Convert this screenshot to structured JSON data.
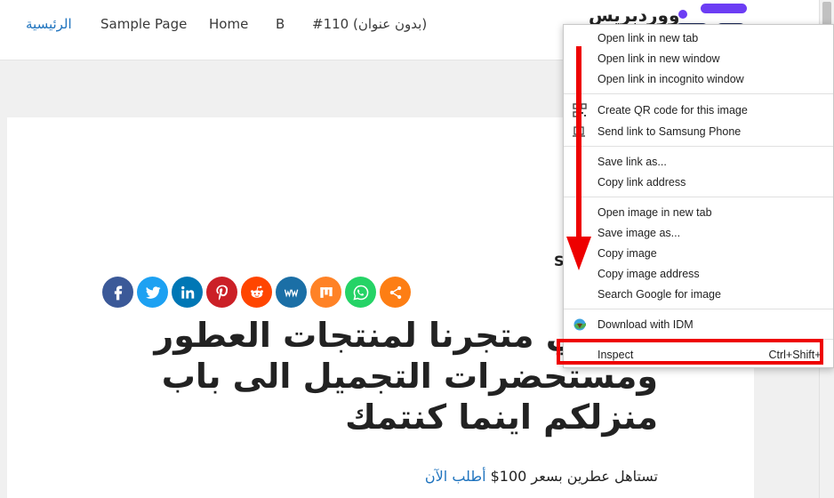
{
  "nav": {
    "home_ar": "الرئيسية",
    "sample_page": "Sample Page",
    "home": "Home",
    "b": "B",
    "untitled": "#110 (بدون عنوان)"
  },
  "logo": {
    "text": "ووردبريس"
  },
  "stray_letter": "S",
  "share": {
    "buttons": [
      {
        "icon": "facebook-icon",
        "color": "#3b5998"
      },
      {
        "icon": "twitter-icon",
        "color": "#1da1f2"
      },
      {
        "icon": "linkedin-icon",
        "color": "#0077b5"
      },
      {
        "icon": "pinterest-icon",
        "color": "#cb2027"
      },
      {
        "icon": "reddit-icon",
        "color": "#ff4500"
      },
      {
        "icon": "mewe-icon",
        "color": "#1b6fa6"
      },
      {
        "icon": "mix-icon",
        "color": "#ff8226"
      },
      {
        "icon": "whatsapp-icon",
        "color": "#25d366"
      },
      {
        "icon": "share-icon",
        "color": "#fd7e14"
      }
    ]
  },
  "post": {
    "title_lines": [
      "بك في متجرنا لمنتجات العطور",
      "ومستحضرات التجميل الى باب",
      "منزلكم اينما كنتمك"
    ],
    "excerpt_text": "تستاهل عطرين بسعر 100$",
    "excerpt_link": "أطلب الآن"
  },
  "context_menu": {
    "items": [
      {
        "label": "Open link in new tab"
      },
      {
        "label": "Open link in new window"
      },
      {
        "label": "Open link in incognito window"
      },
      {
        "label": "Create QR code for this image",
        "icon": "qr-code-icon"
      },
      {
        "label": "Send link to Samsung Phone",
        "icon": "laptop-phone-icon"
      },
      {
        "label": "Save link as..."
      },
      {
        "label": "Copy link address"
      },
      {
        "label": "Open image in new tab"
      },
      {
        "label": "Save image as..."
      },
      {
        "label": "Copy image"
      },
      {
        "label": "Copy image address"
      },
      {
        "label": "Search Google for image"
      },
      {
        "label": "Download with IDM",
        "icon": "idm-globe-icon"
      },
      {
        "label": "Inspect",
        "shortcut": "Ctrl+Shift+I"
      }
    ]
  },
  "colors": {
    "accent": "#1e73be",
    "annotation_red": "#ee0000"
  }
}
